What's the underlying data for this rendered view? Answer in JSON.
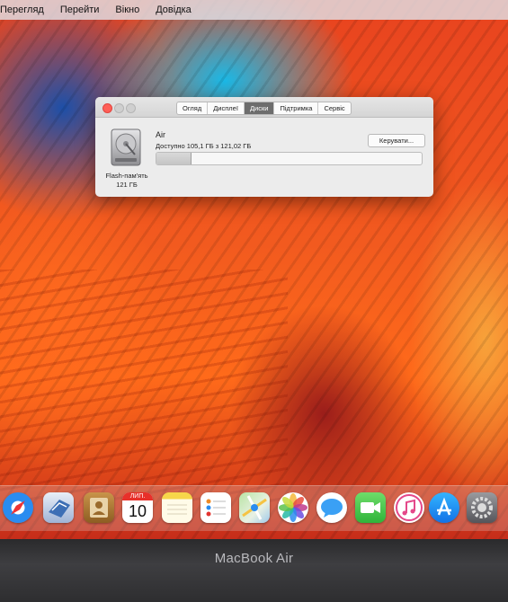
{
  "menubar": {
    "items": [
      "Перегляд",
      "Перейти",
      "Вікно",
      "Довідка"
    ]
  },
  "window": {
    "tabs": [
      {
        "label": "Огляд",
        "active": false
      },
      {
        "label": "Дисплеї",
        "active": false
      },
      {
        "label": "Диски",
        "active": true
      },
      {
        "label": "Підтримка",
        "active": false
      },
      {
        "label": "Сервіс",
        "active": false
      }
    ],
    "disk": {
      "name": "Air",
      "free_text": "Доступно 105,1 ГБ з 121,02 ГБ",
      "caption_line1": "Flash-пам'ять",
      "caption_line2": "121 ГБ",
      "used_fraction": 0.13
    },
    "manage_button": "Керувати..."
  },
  "dock": {
    "calendar_month": "ЛИП.",
    "calendar_day": "10",
    "icons": [
      "safari-icon",
      "mail-icon",
      "contacts-icon",
      "calendar-icon",
      "notes-icon",
      "reminders-icon",
      "maps-icon",
      "photos-icon",
      "messages-icon",
      "facetime-icon",
      "itunes-icon",
      "app-store-icon",
      "system-preferences-icon"
    ]
  },
  "laptop": {
    "brand": "MacBook Air"
  },
  "colors": {
    "close_red": "#ff5f57",
    "active_tab": "#6d6d6d",
    "wallpaper_orange": "#f25a1f",
    "wallpaper_blue": "#1ab8e6"
  }
}
